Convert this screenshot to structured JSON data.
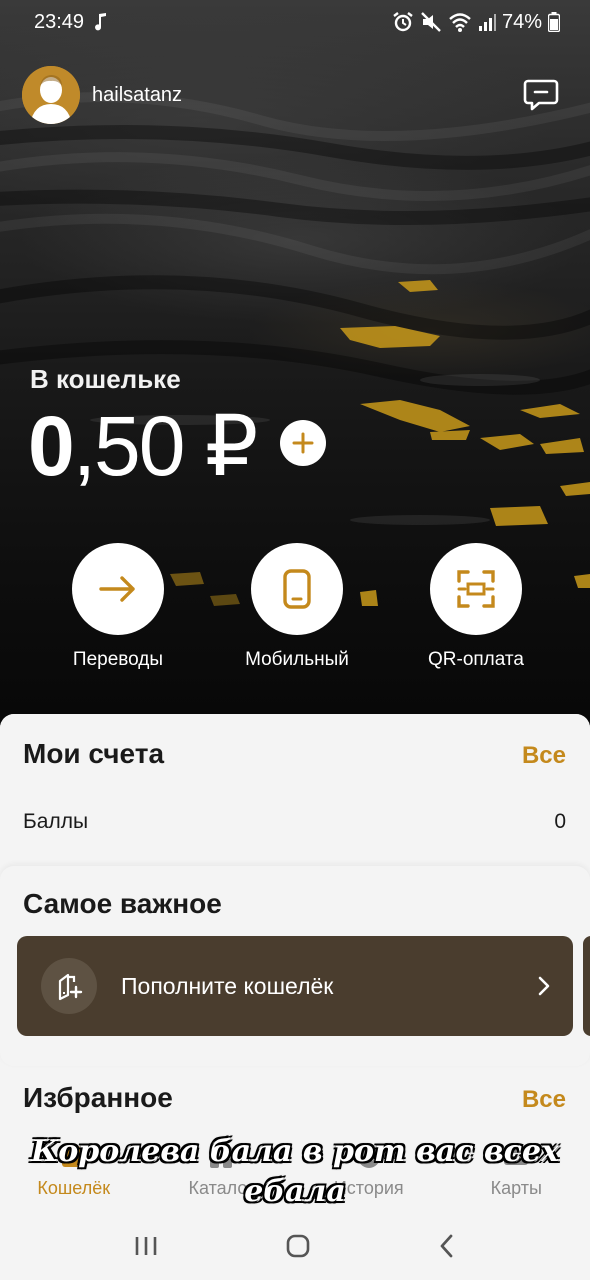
{
  "status_bar": {
    "time": "23:49",
    "battery": "74%",
    "icons": [
      "music-note-icon",
      "alarm-icon",
      "mute-icon",
      "wifi-icon",
      "signal-icon",
      "battery-icon"
    ]
  },
  "header": {
    "username": "hailsatanz",
    "icons": [
      "avatar",
      "chat-icon"
    ]
  },
  "wallet": {
    "label": "В кошельке",
    "balance_whole": "0",
    "balance_rest": ",50 ₽"
  },
  "actions": [
    {
      "label": "Переводы",
      "icon": "arrow-right-icon"
    },
    {
      "label": "Мобильный",
      "icon": "phone-icon"
    },
    {
      "label": "QR-оплата",
      "icon": "qr-scan-icon"
    }
  ],
  "accounts": {
    "title": "Мои счета",
    "all_label": "Все",
    "rows": [
      {
        "label": "Баллы",
        "value": "0"
      }
    ]
  },
  "important": {
    "title": "Самое важное",
    "card_text": "Пополните кошелёк",
    "card_icon": "wallet-topup-icon"
  },
  "favorites": {
    "title": "Избранное",
    "all_label": "Все"
  },
  "bottom_nav": [
    {
      "label": "Кошелёк",
      "active": true
    },
    {
      "label": "Каталог",
      "active": false
    },
    {
      "label": "История",
      "active": false
    },
    {
      "label": "Карты",
      "active": false
    }
  ],
  "overlay_caption": "Королева бала в рот вас всех ебала",
  "colors": {
    "accent": "#c4891c",
    "card_brown": "#4a3d2e",
    "sheet_bg": "#f4f4f4"
  }
}
